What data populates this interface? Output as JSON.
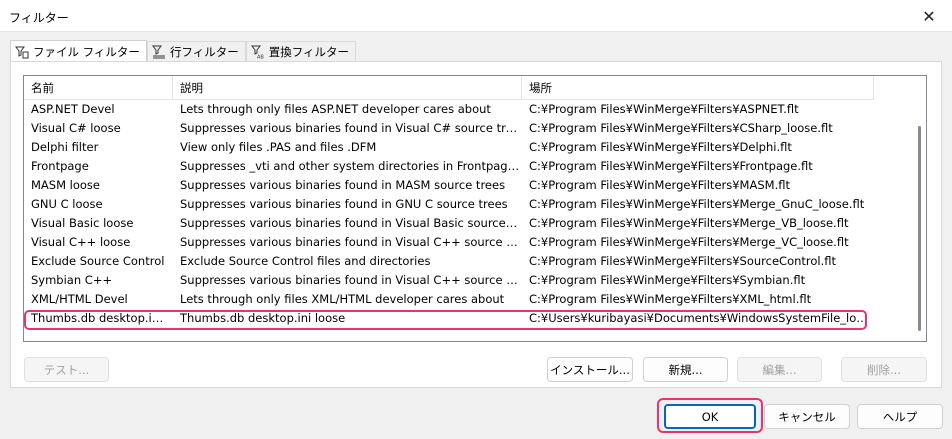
{
  "window": {
    "title": "フィルター",
    "close_glyph": "✕"
  },
  "tabs": [
    {
      "label": "ファイル フィルター",
      "icon": "file-filter-icon",
      "active": true
    },
    {
      "label": "行フィルター",
      "icon": "line-filter-icon",
      "active": false
    },
    {
      "label": "置換フィルター",
      "icon": "substitution-filter-icon",
      "active": false
    }
  ],
  "table": {
    "headers": [
      "名前",
      "説明",
      "場所"
    ],
    "rows": [
      [
        "ASP.NET Devel",
        "Lets through only files ASP.NET developer cares about",
        "C:¥Program Files¥WinMerge¥Filters¥ASPNET.flt"
      ],
      [
        "Visual C# loose",
        "Suppresses various binaries found in Visual C# source trees",
        "C:¥Program Files¥WinMerge¥Filters¥CSharp_loose.flt"
      ],
      [
        "Delphi filter",
        "View only files .PAS and files .DFM",
        "C:¥Program Files¥WinMerge¥Filters¥Delphi.flt"
      ],
      [
        "Frontpage",
        "Suppresses _vti and other system directories in Frontpage web...",
        "C:¥Program Files¥WinMerge¥Filters¥Frontpage.flt"
      ],
      [
        "MASM loose",
        "Suppresses various binaries found in MASM source trees",
        "C:¥Program Files¥WinMerge¥Filters¥MASM.flt"
      ],
      [
        "GNU C loose",
        "Suppresses various binaries found in GNU C source trees",
        "C:¥Program Files¥WinMerge¥Filters¥Merge_GnuC_loose.flt"
      ],
      [
        "Visual Basic loose",
        "Suppresses various binaries found in Visual Basic source trees",
        "C:¥Program Files¥WinMerge¥Filters¥Merge_VB_loose.flt"
      ],
      [
        "Visual C++ loose",
        "Suppresses various binaries found in Visual C++ source trees",
        "C:¥Program Files¥WinMerge¥Filters¥Merge_VC_loose.flt"
      ],
      [
        "Exclude Source Control",
        "Exclude Source Control files and directories",
        "C:¥Program Files¥WinMerge¥Filters¥SourceControl.flt"
      ],
      [
        "Symbian C++",
        "Suppresses various binaries found in Visual C++ source trees c...",
        "C:¥Program Files¥WinMerge¥Filters¥Symbian.flt"
      ],
      [
        "XML/HTML Devel",
        "Lets through only files XML/HTML developer cares about",
        "C:¥Program Files¥WinMerge¥Filters¥XML_html.flt"
      ],
      [
        "Thumbs.db desktop.ini l...",
        "Thumbs.db desktop.ini loose",
        "C:¥Users¥kuribayasi¥Documents¥WindowsSystemFile_loose.flt"
      ]
    ]
  },
  "buttons": {
    "test": "テスト...",
    "install": "インストール...",
    "new": "新規...",
    "edit": "編集...",
    "delete": "削除...",
    "ok": "OK",
    "cancel": "キャンセル",
    "help": "ヘルプ"
  },
  "colors": {
    "highlight": "#e8336e",
    "primary_border": "#0067c0"
  }
}
